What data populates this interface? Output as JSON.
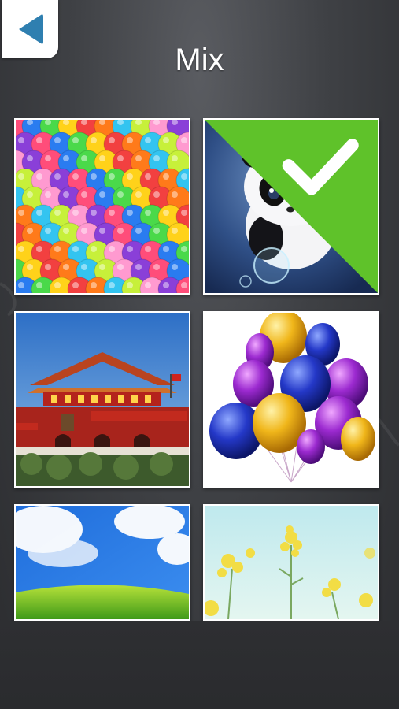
{
  "header": {
    "title": "Mix",
    "back_icon": "back-triangle-icon"
  },
  "colors": {
    "accent_check": "#5fc22a",
    "back_icon": "#2f7fb0",
    "background": "#3f4145"
  },
  "grid": {
    "items": [
      {
        "name": "colorful-balls",
        "selected": false
      },
      {
        "name": "panda",
        "selected": true
      },
      {
        "name": "tiananmen",
        "selected": false
      },
      {
        "name": "balloons",
        "selected": false
      },
      {
        "name": "sky-grass",
        "selected": false
      },
      {
        "name": "yellow-flowers",
        "selected": false
      }
    ]
  }
}
